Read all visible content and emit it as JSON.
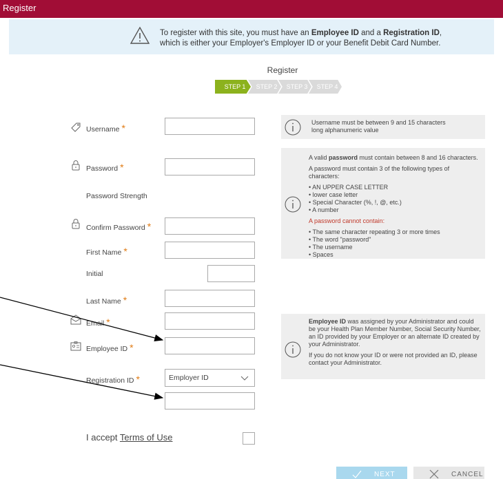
{
  "window": {
    "title": "Register"
  },
  "notice": {
    "line1_pre": "To register with this site, you must have an ",
    "line1_b1": "Employee ID",
    "line1_mid": " and a ",
    "line1_b2": "Registration ID",
    "line1_post": ",",
    "line2": "which is either your Employer's Employer ID or your Benefit Debit Card Number."
  },
  "wizard": {
    "title": "Register",
    "steps": [
      "STEP 1",
      "STEP 2",
      "STEP 3",
      "STEP 4"
    ],
    "active_step": 1
  },
  "form": {
    "required_mark": "*",
    "username_label": "Username",
    "password_label": "Password",
    "strength_label": "Password Strength",
    "confirm_label": "Confirm Password",
    "first_name_label": "First Name",
    "initial_label": "Initial",
    "last_name_label": "Last Name",
    "email_label": "Email",
    "employee_id_label": "Employee ID",
    "registration_id_label": "Registration ID",
    "registration_select_value": "Employer ID",
    "accept_text": "I accept ",
    "terms_link": "Terms of Use"
  },
  "info": {
    "username": "Username must be between 9 and 15 characters long alphanumeric value",
    "pw_pre": "A valid ",
    "pw_b": "password",
    "pw_post": " must contain between 8 and 16 characters.",
    "pw_must3": "A password must contain 3 of the following types of characters:",
    "pw_types": [
      "AN UPPER CASE LETTER",
      "lower case letter",
      "Special Character (%, !, @, etc.)",
      "A number"
    ],
    "pw_cannot": "A password cannot contain:",
    "pw_cannot_items": [
      "The same character repeating 3 or more times",
      "The word \"password\"",
      "The username",
      "Spaces"
    ],
    "emp_b": "Employee ID",
    "emp_text": " was assigned by your Administrator and could be your Health Plan Member Number, Social Security Number, an ID provided by your Employer or an alternate ID created by your Administrator.",
    "emp_contact": "If you do not know your ID or were not provided an ID, please contact your Administrator."
  },
  "buttons": {
    "next": "NEXT",
    "cancel": "CANCEL"
  },
  "colors": {
    "header": "#a10d36",
    "step_active": "#8cb21d",
    "required": "#e07b14",
    "next_button": "#a9d8ee"
  }
}
